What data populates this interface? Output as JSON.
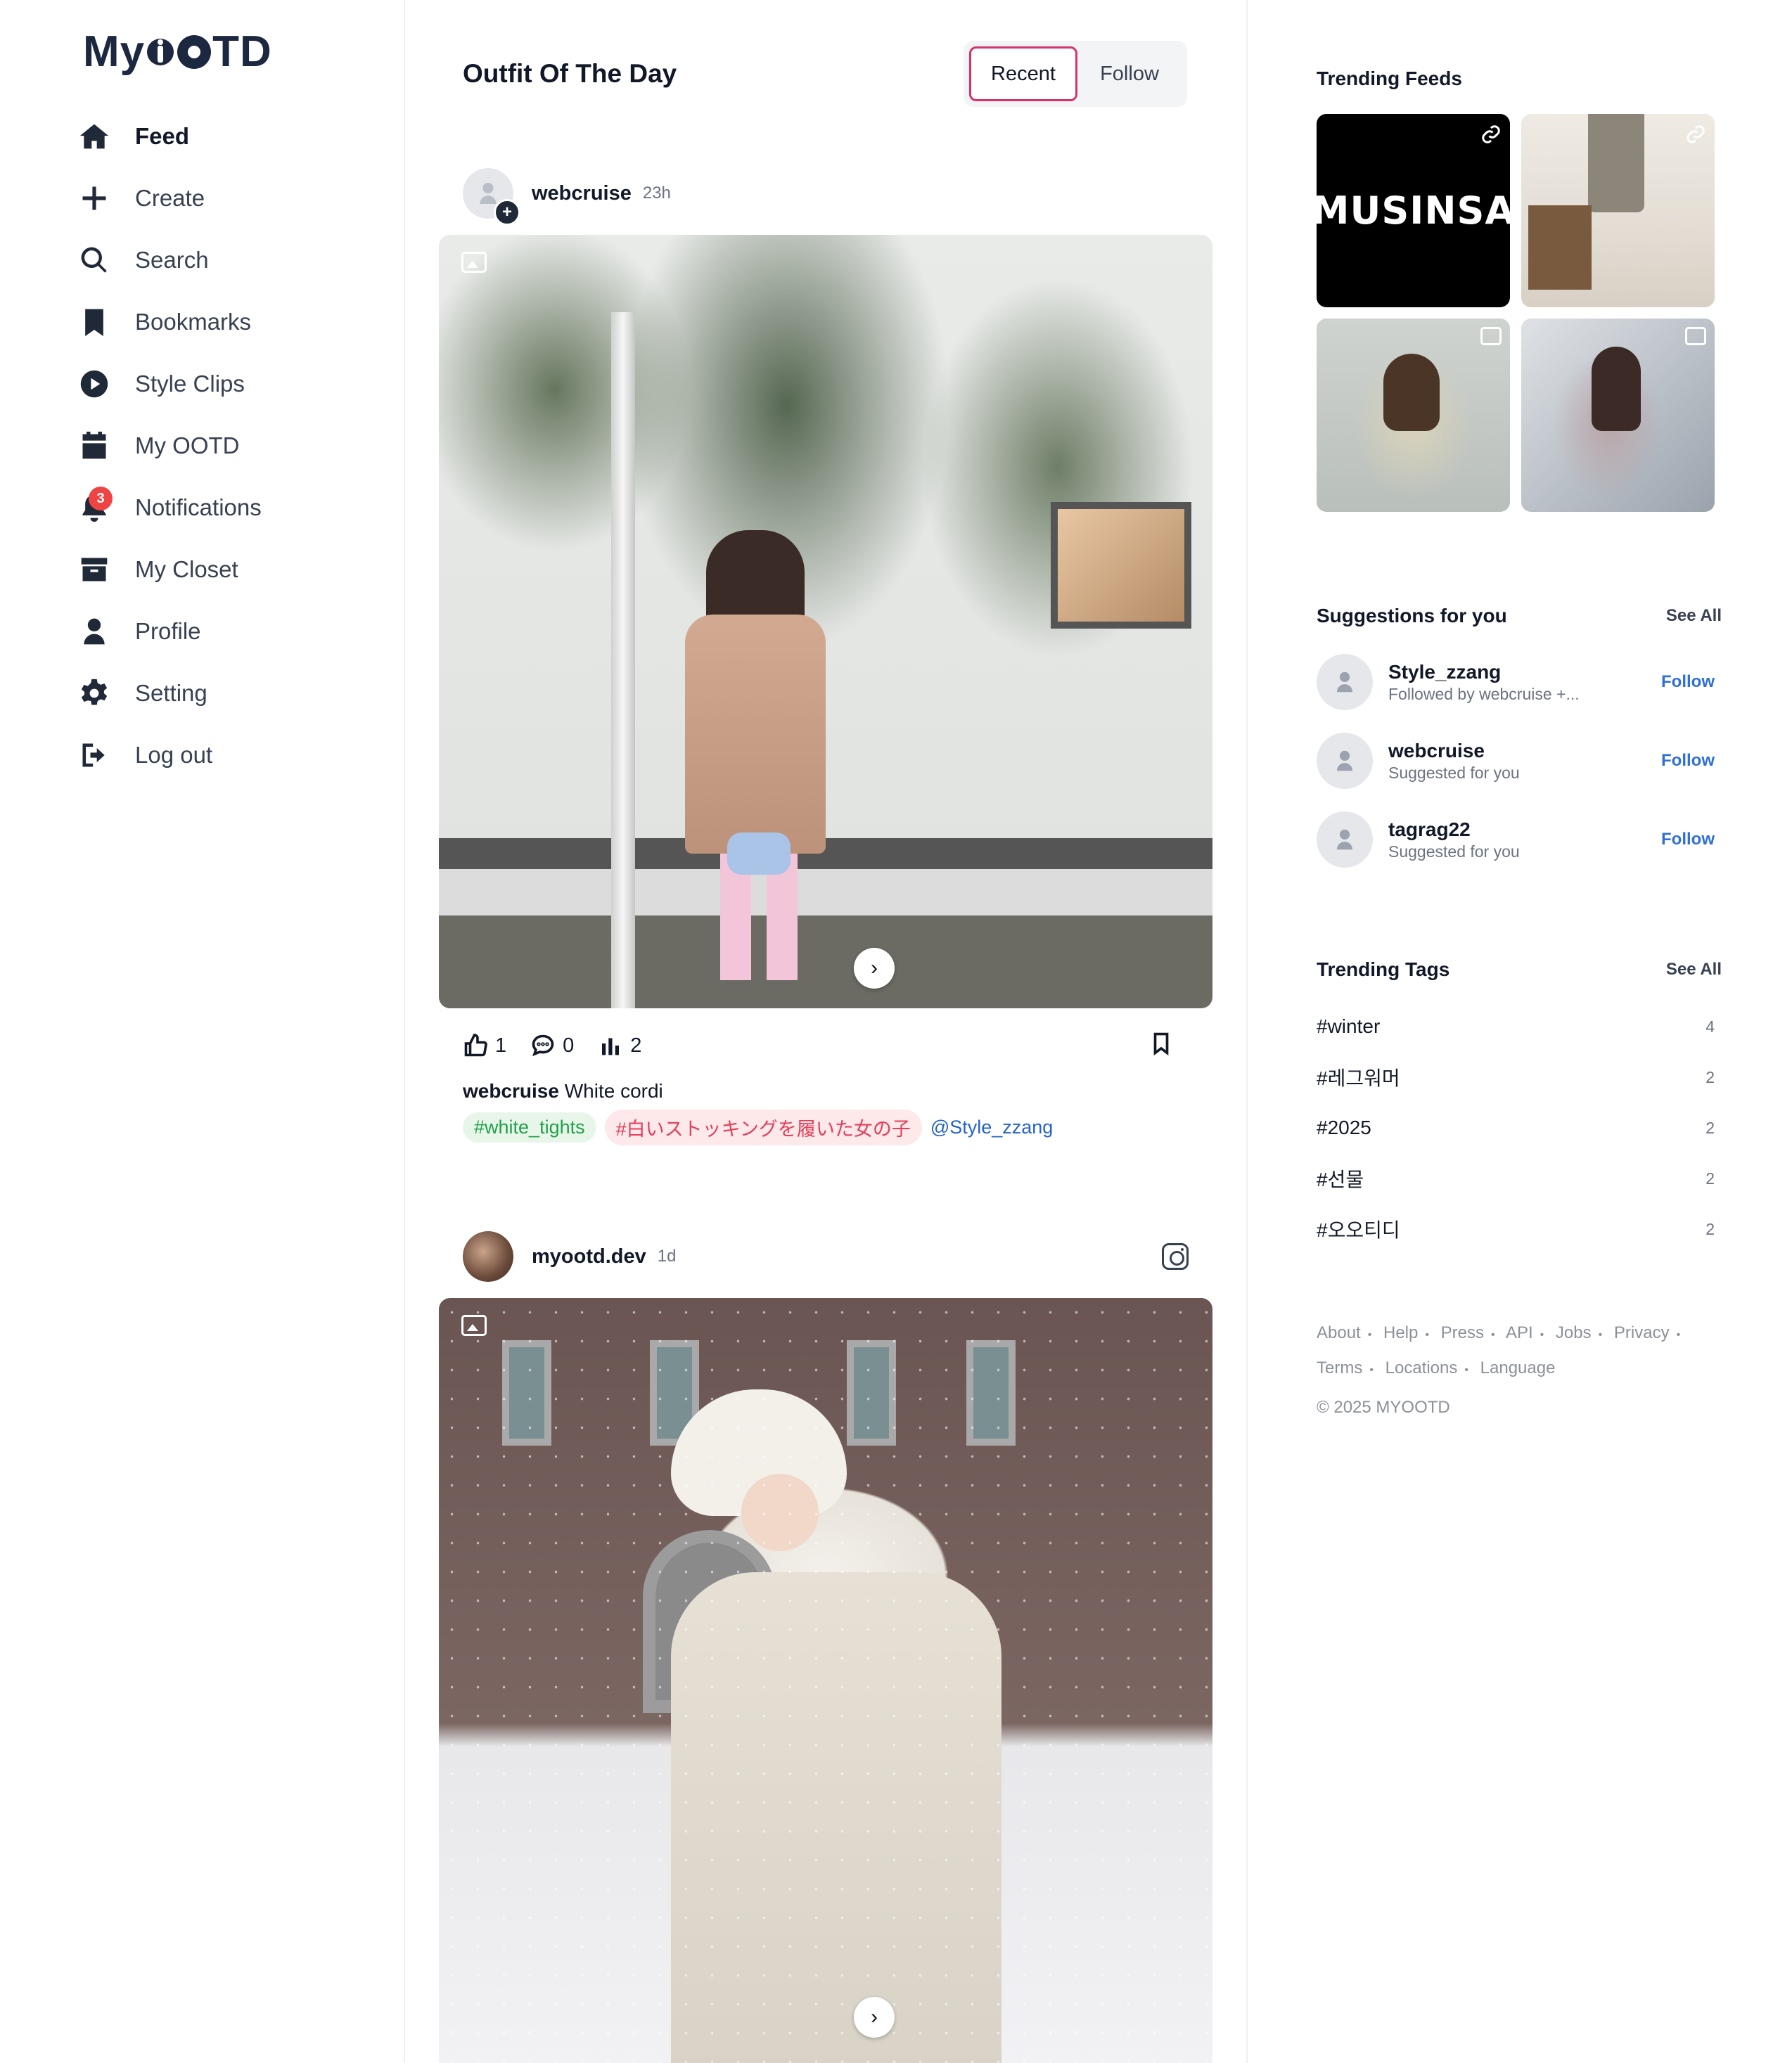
{
  "app": {
    "logo_left": "My",
    "logo_right": "TD"
  },
  "sidebar": {
    "items": [
      {
        "label": "Feed",
        "icon": "home-icon"
      },
      {
        "label": "Create",
        "icon": "plus-icon"
      },
      {
        "label": "Search",
        "icon": "search-icon"
      },
      {
        "label": "Bookmarks",
        "icon": "bookmark-icon"
      },
      {
        "label": "Style Clips",
        "icon": "play-icon"
      },
      {
        "label": "My OOTD",
        "icon": "calendar-icon"
      },
      {
        "label": "Notifications",
        "icon": "bell-icon",
        "badge": "3"
      },
      {
        "label": "My Closet",
        "icon": "archive-icon"
      },
      {
        "label": "Profile",
        "icon": "user-icon"
      },
      {
        "label": "Setting",
        "icon": "gear-icon"
      },
      {
        "label": "Log out",
        "icon": "logout-icon"
      }
    ]
  },
  "main": {
    "title": "Outfit Of The Day",
    "toggle": {
      "recent": "Recent",
      "follow": "Follow",
      "active": "recent"
    },
    "posts": [
      {
        "username": "webcruise",
        "time": "23h",
        "likes": "1",
        "comments": "0",
        "views": "2",
        "caption_user": "webcruise",
        "caption_text": "White cordi",
        "tags": [
          "#white_tights",
          "#白いストッキングを履いた女の子"
        ],
        "mention": "@Style_zzang"
      },
      {
        "username": "myootd.dev",
        "time": "1d"
      }
    ]
  },
  "right": {
    "trending_feeds_title": "Trending Feeds",
    "trending_feed_tiles": [
      {
        "text": "MUSINSA",
        "icon": "link-icon"
      },
      {
        "icon": "link-icon"
      },
      {
        "icon": "gallery-icon"
      },
      {
        "icon": "gallery-icon"
      }
    ],
    "suggestions_title": "Suggestions for you",
    "suggestions_see_all": "See All",
    "suggestions": [
      {
        "name": "Style_zzang",
        "sub": "Followed by webcruise +...",
        "action": "Follow"
      },
      {
        "name": "webcruise",
        "sub": "Suggested for you",
        "action": "Follow"
      },
      {
        "name": "tagrag22",
        "sub": "Suggested for you",
        "action": "Follow"
      }
    ],
    "tags_title": "Trending Tags",
    "tags_see_all": "See All",
    "tags": [
      {
        "name": "#winter",
        "count": "4"
      },
      {
        "name": "#레그워머",
        "count": "2"
      },
      {
        "name": "#2025",
        "count": "2"
      },
      {
        "name": "#선물",
        "count": "2"
      },
      {
        "name": "#오오티디",
        "count": "2"
      }
    ],
    "footer_links": [
      "About",
      "Help",
      "Press",
      "API",
      "Jobs",
      "Privacy",
      "Terms",
      "Locations",
      "Language"
    ],
    "copyright": "© 2025 MYOOTD"
  },
  "colors": {
    "accent": "#d6336c",
    "link": "#2f6fd6",
    "brand": "#1c2740",
    "badge": "#ef4444"
  }
}
